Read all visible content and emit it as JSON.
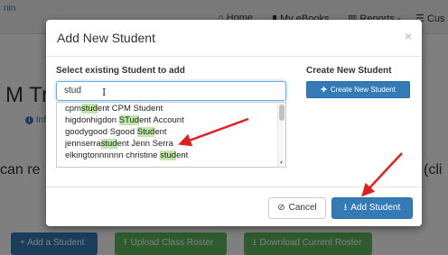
{
  "background": {
    "brand": "nin",
    "nav": [
      {
        "label": "Home",
        "icon": "home-icon"
      },
      {
        "label": "My eBooks",
        "icon": "book-icon"
      },
      {
        "label": "Reports -",
        "icon": "bar-chart-icon"
      },
      {
        "label": "Cus",
        "icon": "list-icon"
      }
    ],
    "heading": "M Tra",
    "info_text": "Inf",
    "can_text": "can re",
    "cli_text": "(cli",
    "buttons": {
      "add_student": "+ Add a Student",
      "upload_roster": "Upload Class Roster",
      "download_roster": "Download Current Roster"
    }
  },
  "modal": {
    "title": "Add New Student",
    "close": "×",
    "existing_label": "Select existing Student to add",
    "create_label": "Create New Student",
    "create_button": "Create New Student",
    "search": {
      "value": "stud"
    },
    "results": [
      {
        "pre": "cpm",
        "hl": "stud",
        "post": "ent CPM Student"
      },
      {
        "pre": "higdonhigdon ",
        "hl": "STud",
        "post": "ent Account"
      },
      {
        "pre": "goodygood Sgood ",
        "hl": "Stud",
        "post": "ent"
      },
      {
        "pre": "jennserra",
        "hl": "stud",
        "post": "ent Jenn Serra"
      },
      {
        "pre": "elkingtonnnnnn christine ",
        "hl": "stud",
        "post": "ent"
      }
    ],
    "cancel_button": "Cancel",
    "add_button": "Add Student"
  },
  "colors": {
    "primary": "#337ab7",
    "success": "#5cb85c",
    "highlight": "#bfe8a8",
    "annotation_arrow": "#e02020"
  }
}
